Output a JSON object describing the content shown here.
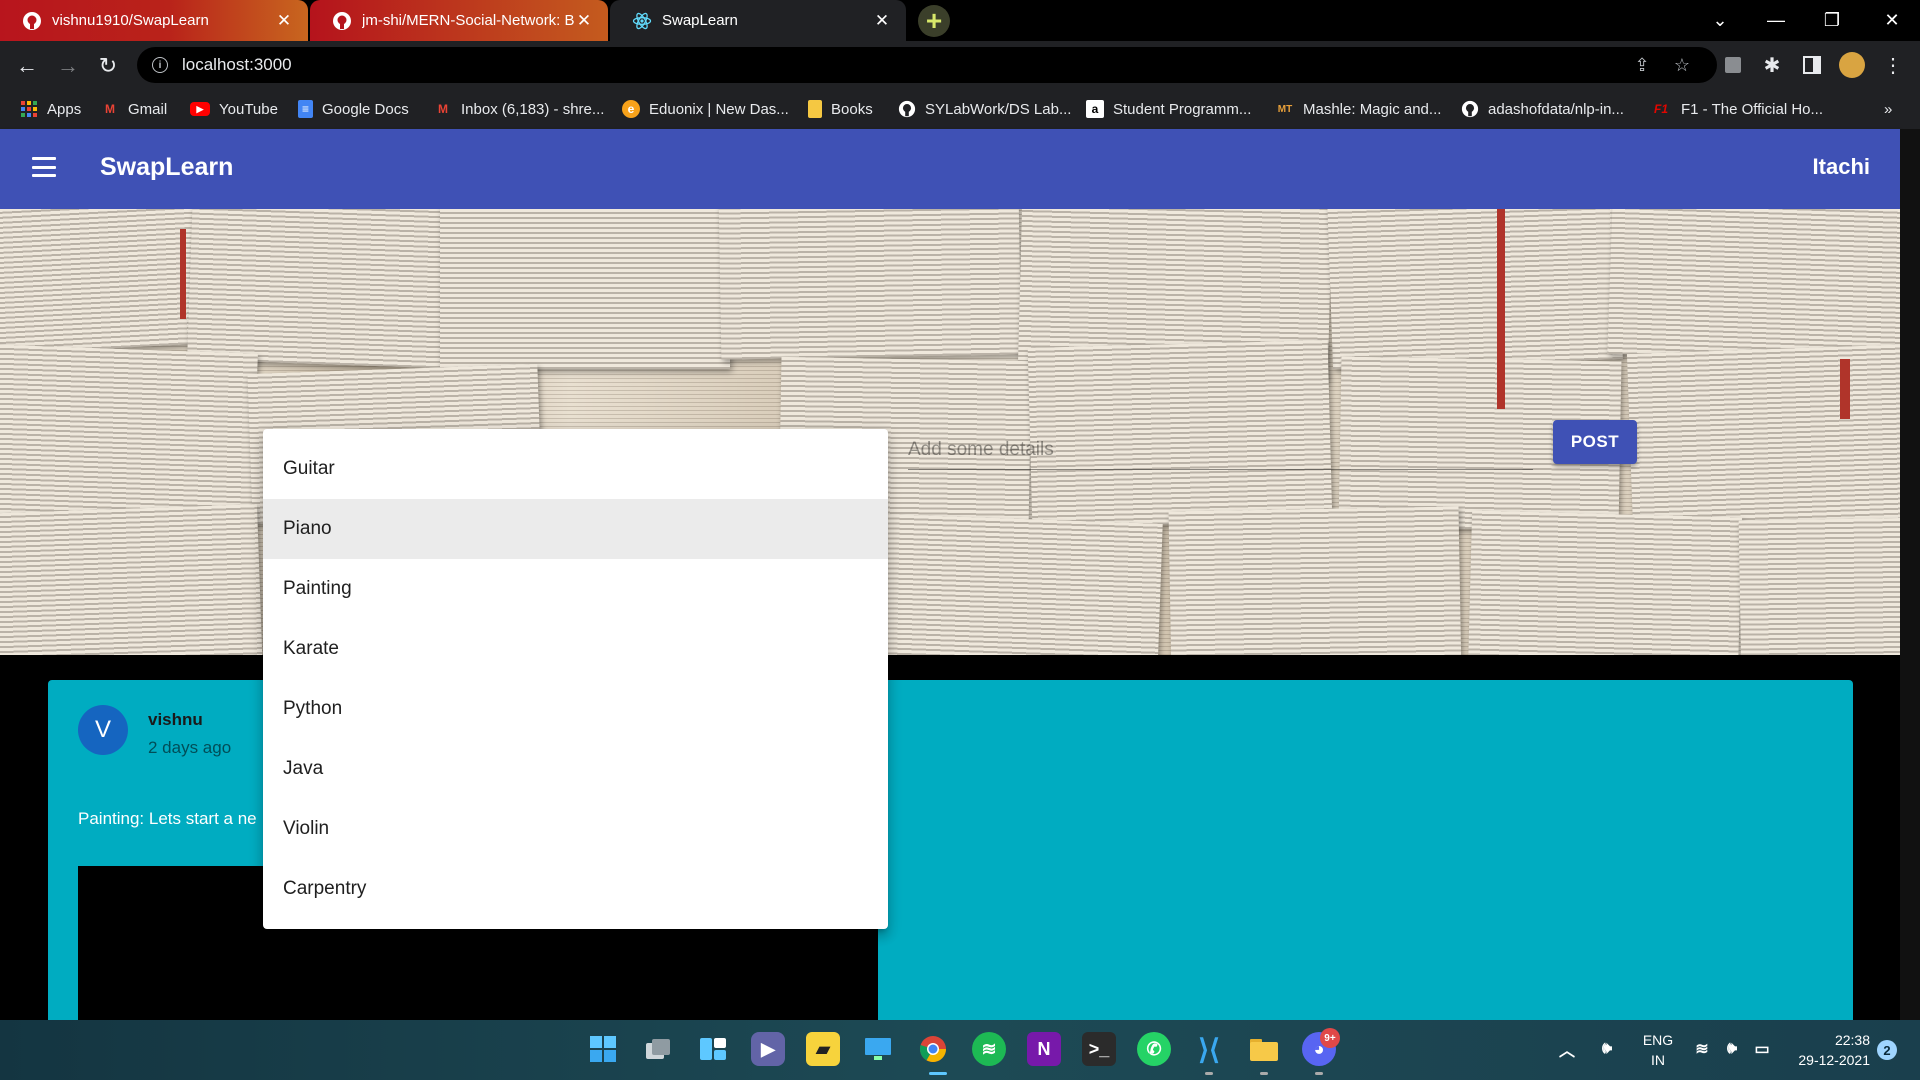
{
  "browser": {
    "tabs": [
      {
        "title": "vishnu1910/SwapLearn",
        "icon": "github-icon"
      },
      {
        "title": "jm-shi/MERN-Social-Network: Bu",
        "icon": "github-icon"
      },
      {
        "title": "SwapLearn",
        "icon": "react-icon",
        "active": true
      }
    ],
    "url": "localhost:3000",
    "bookmarks": [
      {
        "label": "Apps",
        "icon": "apps-grid-icon"
      },
      {
        "label": "Gmail",
        "icon": "gmail-icon"
      },
      {
        "label": "YouTube",
        "icon": "youtube-icon"
      },
      {
        "label": "Google Docs",
        "icon": "docs-icon"
      },
      {
        "label": "Inbox (6,183) - shre...",
        "icon": "gmail-icon"
      },
      {
        "label": "Eduonix | New Das...",
        "icon": "eduonix-icon"
      },
      {
        "label": "Books",
        "icon": "folder-icon"
      },
      {
        "label": "SYLabWork/DS Lab...",
        "icon": "github-icon"
      },
      {
        "label": "Student Programm...",
        "icon": "amazon-icon"
      },
      {
        "label": "Mashle: Magic and...",
        "icon": "manga-icon"
      },
      {
        "label": "adashofdata/nlp-in...",
        "icon": "github-icon"
      },
      {
        "label": "F1 - The Official Ho...",
        "icon": "f1-icon"
      }
    ],
    "more": "»"
  },
  "app": {
    "title": "SwapLearn",
    "user": "Itachi",
    "form": {
      "details_placeholder": "Add some details",
      "post_label": "POST"
    },
    "dropdown": {
      "options": [
        "Guitar",
        "Piano",
        "Painting",
        "Karate",
        "Python",
        "Java",
        "Violin",
        "Carpentry"
      ],
      "highlighted": "Piano"
    },
    "post": {
      "avatar": "V",
      "author": "vishnu",
      "time": "2 days ago",
      "text": "Painting: Lets start a ne"
    }
  },
  "taskbar": {
    "lang": "ENG",
    "region": "IN",
    "time": "22:38",
    "date": "29-12-2021",
    "notifications": "2",
    "discord_badge": "9+"
  },
  "colors": {
    "appbar": "#3f51b5",
    "card": "#00acc1",
    "avatar": "#1565c0"
  }
}
